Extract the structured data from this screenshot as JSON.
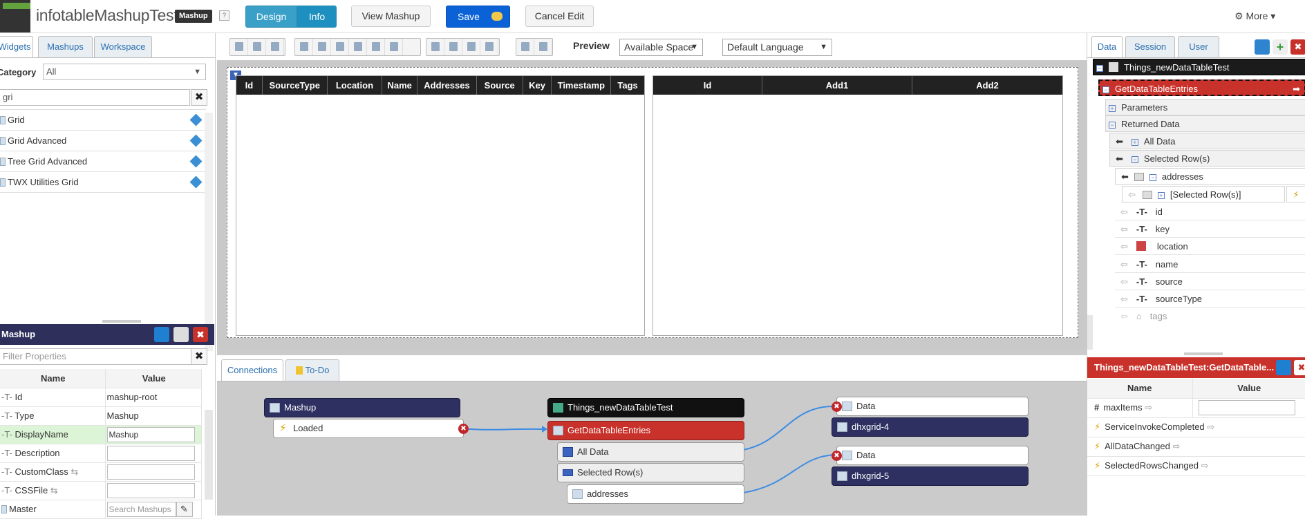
{
  "header": {
    "title": "infotableMashupTest",
    "badge": "Mashup",
    "help": "?",
    "design": "Design",
    "info": "Info",
    "view": "View Mashup",
    "save": "Save",
    "cancel": "Cancel Edit",
    "more": "More"
  },
  "left": {
    "tabs": [
      "Widgets",
      "Mashups",
      "Workspace"
    ],
    "category_label": "Category",
    "category_value": "All",
    "search": "gri",
    "clear": "✖",
    "widgets": [
      "Grid",
      "Grid Advanced",
      "Tree Grid Advanced",
      "TWX Utilities Grid"
    ]
  },
  "props": {
    "title": "Mashup",
    "filter_placeholder": "Filter Properties",
    "col_name": "Name",
    "col_value": "Value",
    "rows": [
      {
        "name": "Id",
        "value": "mashup-root"
      },
      {
        "name": "Type",
        "value": "Mashup"
      },
      {
        "name": "DisplayName",
        "value": "Mashup"
      },
      {
        "name": "Description",
        "value": ""
      },
      {
        "name": "CustomClass",
        "value": ""
      },
      {
        "name": "CSSFile",
        "value": ""
      },
      {
        "name": "Master",
        "value": "Search Mashups"
      }
    ]
  },
  "toolbar": {
    "preview": "Preview",
    "space": "Available Space",
    "language": "Default Language"
  },
  "grid1": {
    "cols": [
      "Id",
      "SourceType",
      "Location",
      "Name",
      "Addresses",
      "Source",
      "Key",
      "Timestamp",
      "Tags"
    ]
  },
  "grid2": {
    "cols": [
      "Id",
      "Add1",
      "Add2"
    ]
  },
  "bottom": {
    "tabs": [
      "Connections",
      "To-Do"
    ],
    "mashup": "Mashup",
    "loaded": "Loaded",
    "thing": "Things_newDataTableTest",
    "service": "GetDataTableEntries",
    "alldata": "All Data",
    "selrows": "Selected Row(s)",
    "addresses": "addresses",
    "data1": "Data",
    "grid4": "dhxgrid-4",
    "data2": "Data",
    "grid5": "dhxgrid-5"
  },
  "right": {
    "tabs": [
      "Data",
      "Session",
      "User"
    ],
    "thing": "Things_newDataTableTest",
    "service": "GetDataTableEntries",
    "parameters": "Parameters",
    "returned": "Returned Data",
    "alldata": "All Data",
    "selrows": "Selected Row(s)",
    "addresses": "addresses",
    "selrows2": "[Selected Row(s)]",
    "fields": [
      "id",
      "key",
      "location",
      "name",
      "source",
      "sourceType",
      "tags"
    ],
    "ph_title": "Things_newDataTableTest:GetDataTable...",
    "ph_col_name": "Name",
    "ph_col_value": "Value",
    "ph_rows": [
      "maxItems",
      "ServiceInvokeCompleted",
      "AllDataChanged",
      "SelectedRowsChanged"
    ]
  }
}
